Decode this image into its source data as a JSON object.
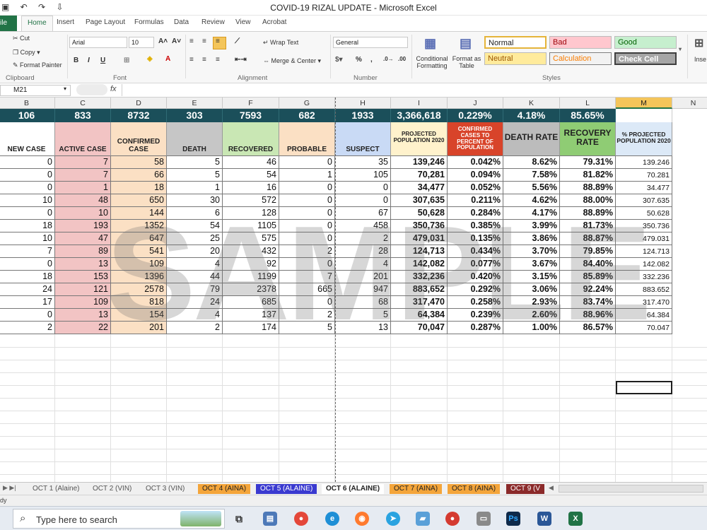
{
  "window": {
    "title": "COVID-19 RIZAL UPDATE  -  Microsoft Excel",
    "qat": "▣ ↶ ↷ ⇩"
  },
  "tabs": {
    "file": "ile",
    "home": "Home",
    "insert": "Insert",
    "page_layout": "Page Layout",
    "formulas": "Formulas",
    "data": "Data",
    "review": "Review",
    "view": "View",
    "acrobat": "Acrobat"
  },
  "ribbon": {
    "clipboard": {
      "cut": "Cut",
      "copy": "Copy",
      "format_painter": "Format Painter",
      "label": "Clipboard"
    },
    "font": {
      "name": "Arial",
      "size": "10",
      "label": "Font"
    },
    "alignment": {
      "wrap": "Wrap Text",
      "merge": "Merge & Center",
      "label": "Alignment"
    },
    "number": {
      "format": "General",
      "percent": "%",
      "comma": ",",
      "label": "Number"
    },
    "styles": {
      "conditional": "Conditional Formatting",
      "format_table": "Format as Table",
      "normal": "Normal",
      "bad": "Bad",
      "good": "Good",
      "neutral": "Neutral",
      "calculation": "Calculation",
      "check_cell": "Check Cell",
      "label": "Styles"
    },
    "insert_label": "Inse"
  },
  "formula_bar": {
    "name_box": "M21",
    "fx": "fx"
  },
  "columns": [
    "B",
    "C",
    "D",
    "E",
    "F",
    "G",
    "H",
    "I",
    "J",
    "K",
    "L",
    "M",
    "N"
  ],
  "totals": [
    "106",
    "833",
    "8732",
    "303",
    "7593",
    "682",
    "1933",
    "3,366,618",
    "0.229%",
    "4.18%",
    "85.65%",
    ""
  ],
  "headers": [
    "NEW CASE",
    "ACTIVE CASE",
    "CONFIRMED CASE",
    "DEATH",
    "RECOVERED",
    "PROBABLE",
    "SUSPECT",
    "PROJECTED POPULATION 2020",
    "CONFIRMED CASES TO PERCENT OF POPULATION",
    "DEATH RATE",
    "RECOVERY RATE",
    "% PROJECTED POPULATION 2020"
  ],
  "rows": [
    [
      "0",
      "7",
      "58",
      "5",
      "46",
      "0",
      "35",
      "139,246",
      "0.042%",
      "8.62%",
      "79.31%",
      "139.246"
    ],
    [
      "0",
      "7",
      "66",
      "5",
      "54",
      "1",
      "105",
      "70,281",
      "0.094%",
      "7.58%",
      "81.82%",
      "70.281"
    ],
    [
      "0",
      "1",
      "18",
      "1",
      "16",
      "0",
      "0",
      "34,477",
      "0.052%",
      "5.56%",
      "88.89%",
      "34.477"
    ],
    [
      "10",
      "48",
      "650",
      "30",
      "572",
      "0",
      "0",
      "307,635",
      "0.211%",
      "4.62%",
      "88.00%",
      "307.635"
    ],
    [
      "0",
      "10",
      "144",
      "6",
      "128",
      "0",
      "67",
      "50,628",
      "0.284%",
      "4.17%",
      "88.89%",
      "50.628"
    ],
    [
      "18",
      "193",
      "1352",
      "54",
      "1105",
      "0",
      "458",
      "350,736",
      "0.385%",
      "3.99%",
      "81.73%",
      "350.736"
    ],
    [
      "10",
      "47",
      "647",
      "25",
      "575",
      "0",
      "2",
      "479,031",
      "0.135%",
      "3.86%",
      "88.87%",
      "479.031"
    ],
    [
      "7",
      "89",
      "541",
      "20",
      "432",
      "2",
      "28",
      "124,713",
      "0.434%",
      "3.70%",
      "79.85%",
      "124.713"
    ],
    [
      "0",
      "13",
      "109",
      "4",
      "92",
      "0",
      "4",
      "142,082",
      "0.077%",
      "3.67%",
      "84.40%",
      "142.082"
    ],
    [
      "18",
      "153",
      "1396",
      "44",
      "1199",
      "7",
      "201",
      "332,236",
      "0.420%",
      "3.15%",
      "85.89%",
      "332.236"
    ],
    [
      "24",
      "121",
      "2578",
      "79",
      "2378",
      "665",
      "947",
      "883,652",
      "0.292%",
      "3.06%",
      "92.24%",
      "883.652"
    ],
    [
      "17",
      "109",
      "818",
      "24",
      "685",
      "0",
      "68",
      "317,470",
      "0.258%",
      "2.93%",
      "83.74%",
      "317.470"
    ],
    [
      "0",
      "13",
      "154",
      "4",
      "137",
      "2",
      "5",
      "64,384",
      "0.239%",
      "2.60%",
      "88.96%",
      "64.384"
    ],
    [
      "2",
      "22",
      "201",
      "2",
      "174",
      "5",
      "13",
      "70,047",
      "0.287%",
      "1.00%",
      "86.57%",
      "70.047"
    ]
  ],
  "watermark": "SAMPLE",
  "sheets": [
    "OCT 1 (Alaine)",
    "OCT 2 (VIN)",
    "OCT 3 (VIN)",
    "OCT 4 (AINA)",
    "OCT 5 (ALAINE)",
    "OCT 6 (ALAINE)",
    "OCT 7 (AINA)",
    "OCT 8 (AINA)",
    "OCT 9 (V"
  ],
  "status": {
    "mode": "dy"
  },
  "taskbar": {
    "search_placeholder": "Type here to search",
    "apps": [
      "Ps",
      "W",
      "X"
    ]
  },
  "colors": {
    "header_teal": "#1b4f5a",
    "active_case_red": "#f2c4c4",
    "confirmed_peach": "#fbe0c4",
    "death_gray": "#c6c6c6",
    "recovered_green": "#c9e7b4",
    "probable_orange": "#fbe0c4",
    "suspect_blue": "#c9daf5",
    "pop_yellow": "#fff2cc",
    "pct_red": "#d8442a",
    "rate_gray": "#bcbcbc",
    "recovery_green": "#8fcc74",
    "mhdr_blue": "#dce9f7"
  }
}
